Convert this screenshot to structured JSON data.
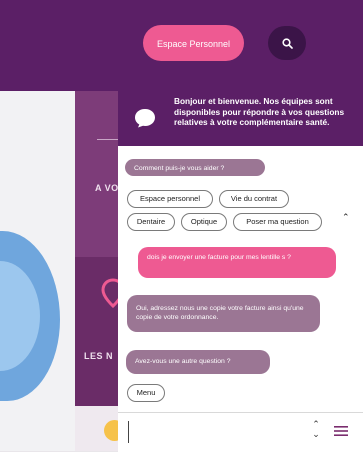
{
  "header": {
    "espace_button": "Espace Personnel",
    "search_icon": "search-icon"
  },
  "background": {
    "text_avo": "A VO",
    "text_lesn": "LES N"
  },
  "chat": {
    "welcome": "Bonjour et bienvenue. Nos équipes sont disponibles pour répondre à vos questions relatives à votre complémentaire santé.",
    "messages": {
      "bot_question": "Comment puis-je vous aider ?",
      "user_message": "dois je envoyer une facture pour mes lentille s ?",
      "bot_answer": "Oui, adressez nous une copie votre facture ainsi qu'une copie de votre ordonnance.",
      "bot_followup": "Avez-vous une autre question ?"
    },
    "quick_replies": [
      "Espace personnel",
      "Vie du contrat",
      "Dentaire",
      "Optique",
      "Poser ma question"
    ],
    "menu_button": "Menu",
    "input_value": ""
  },
  "colors": {
    "primary_purple": "#5b1f66",
    "accent_pink": "#ee5a92",
    "bot_bubble": "#9b7694"
  }
}
